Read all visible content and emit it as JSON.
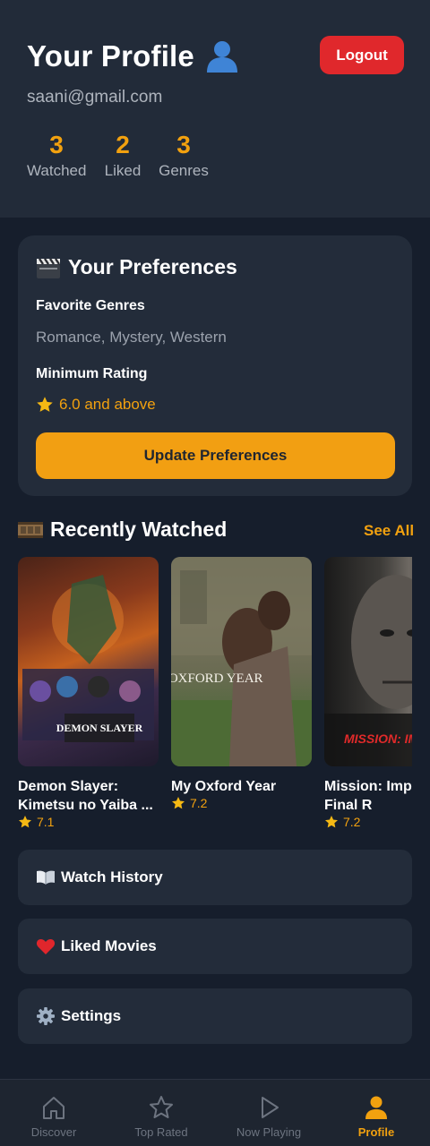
{
  "header": {
    "title": "Your Profile",
    "email": "saani@gmail.com",
    "logout_label": "Logout",
    "stats": [
      {
        "value": "3",
        "label": "Watched"
      },
      {
        "value": "2",
        "label": "Liked"
      },
      {
        "value": "3",
        "label": "Genres"
      }
    ]
  },
  "preferences": {
    "title": "Your Preferences",
    "genres_label": "Favorite Genres",
    "genres_value": "Romance, Mystery, Western",
    "rating_label": "Minimum Rating",
    "rating_value": "6.0 and above",
    "update_label": "Update Preferences"
  },
  "recently_watched": {
    "title": "Recently Watched",
    "see_all": "See All",
    "movies": [
      {
        "title": "Demon Slayer: Kimetsu no Yaiba ...",
        "rating": "7.1",
        "poster_text": "DEMON SLAYER"
      },
      {
        "title": "My Oxford Year",
        "rating": "7.2",
        "poster_text": "MY OXFORD YEAR"
      },
      {
        "title": "Mission: Imp - The Final R",
        "rating": "7.2",
        "poster_text": "MISSION: IMPO"
      }
    ]
  },
  "menu": {
    "watch_history": "Watch History",
    "liked_movies": "Liked Movies",
    "settings": "Settings"
  },
  "nav": {
    "items": [
      {
        "label": "Discover",
        "icon": "home-icon"
      },
      {
        "label": "Top Rated",
        "icon": "star-icon"
      },
      {
        "label": "Now Playing",
        "icon": "play-icon"
      },
      {
        "label": "Profile",
        "icon": "person-icon"
      }
    ],
    "active_index": 3
  },
  "colors": {
    "accent": "#f2a10f",
    "logout": "#e0282c",
    "background": "#161e2c",
    "card": "#232c3a"
  }
}
